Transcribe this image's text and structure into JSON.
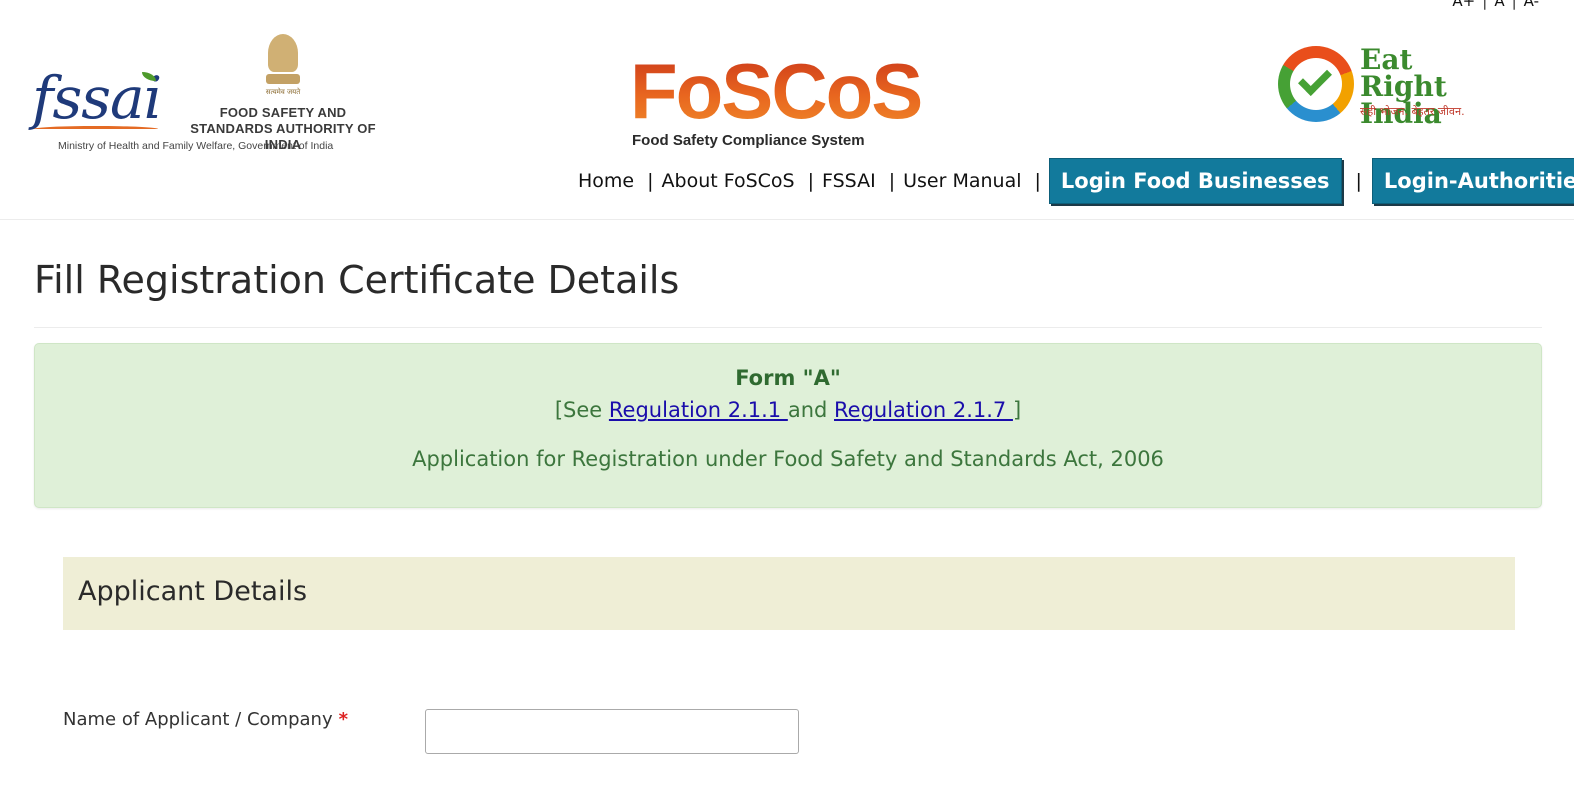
{
  "font_controls": {
    "increase": "A+",
    "normal": "A",
    "decrease": "A-"
  },
  "header": {
    "fssai_logo_text": "fssai",
    "emblem_motto": "सत्यमेव जयते",
    "authority_name": "FOOD SAFETY AND STANDARDS AUTHORITY OF INDIA",
    "ministry": "Ministry of Health and Family Welfare, Government of India",
    "foscos_logo_text": "FoSCoS",
    "foscos_tagline": "Food Safety Compliance System",
    "eri_logo_text": "Eat Right India",
    "eri_tagline": "सही भोजन. बेहतर जीवन."
  },
  "nav": {
    "home": "Home",
    "about": "About FoSCoS",
    "fssai": "FSSAI",
    "manual": "User Manual",
    "login_fbo": "Login Food Businesses",
    "login_auth": "Login-Authorities",
    "separator": "|"
  },
  "page": {
    "title": "Fill Registration Certificate Details"
  },
  "form_alert": {
    "form_name": "Form \"A\"",
    "see_prefix": "[See ",
    "regulation_1": "Regulation 2.1.1 ",
    "and_text": "and ",
    "regulation_2": "Regulation 2.1.7 ",
    "close_bracket": "]",
    "purpose": "Application for Registration under Food Safety and Standards Act, 2006"
  },
  "applicant": {
    "section_title": "Applicant Details",
    "name_label": "Name of Applicant / Company",
    "required_mark": "*",
    "name_value": ""
  },
  "colors": {
    "nav_button": "#127a9c",
    "alert_bg": "#dff0d8",
    "alert_text": "#3c763d",
    "section_bg": "#efeed6",
    "foscos_orange": "#e05a1c",
    "fssai_blue": "#1f3a7a"
  }
}
